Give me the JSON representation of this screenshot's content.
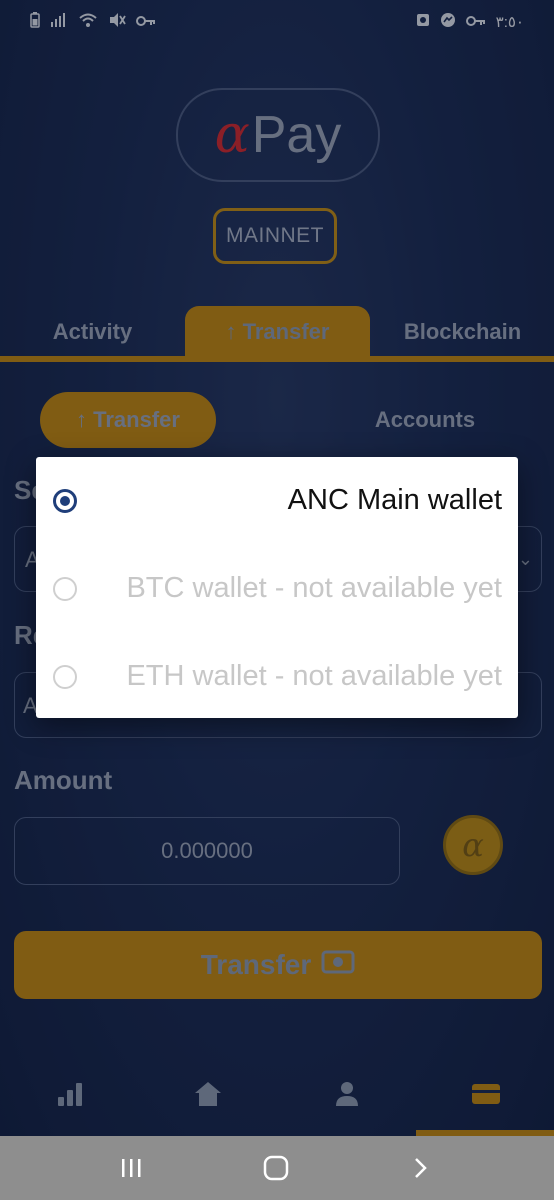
{
  "status_bar": {
    "time": "٣:٥٠",
    "left_icons": [
      "battery-icon",
      "signal-icon",
      "wifi-icon",
      "mute-icon",
      "key-icon"
    ],
    "right_icons": [
      "app-notification-icon",
      "messenger-icon",
      "key-icon"
    ]
  },
  "logo": {
    "alpha": "α",
    "text": "Pay"
  },
  "network": {
    "label": "MAINNET"
  },
  "tabs": [
    {
      "label": "Activity"
    },
    {
      "label": "↑ Transfer",
      "active": true
    },
    {
      "label": "Blockchain"
    }
  ],
  "subtabs": [
    {
      "label": "↑ Transfer",
      "active": true
    },
    {
      "label": "Accounts"
    }
  ],
  "form": {
    "sender_label_partial": "Se",
    "sender_value_partial": "A",
    "receiver_label_partial": "Re",
    "receiver_value_partial": "A",
    "amount_label": "Amount",
    "amount_value": "0.000000",
    "coin_symbol": "α"
  },
  "transfer_button": {
    "label": "Transfer"
  },
  "bottom_nav": [
    "chart-icon",
    "home-icon",
    "user-icon",
    "wallet-icon"
  ],
  "dialog": {
    "options": [
      {
        "label": "ANC Main wallet",
        "selected": true,
        "enabled": true
      },
      {
        "label": "BTC wallet - not available yet",
        "selected": false,
        "enabled": false
      },
      {
        "label": "ETH wallet - not available yet",
        "selected": false,
        "enabled": false
      }
    ]
  },
  "colors": {
    "accent": "#c1860f",
    "background": "#1a2a52",
    "radio_selected": "#1f3e7a",
    "logo_alpha": "#d2282d"
  }
}
